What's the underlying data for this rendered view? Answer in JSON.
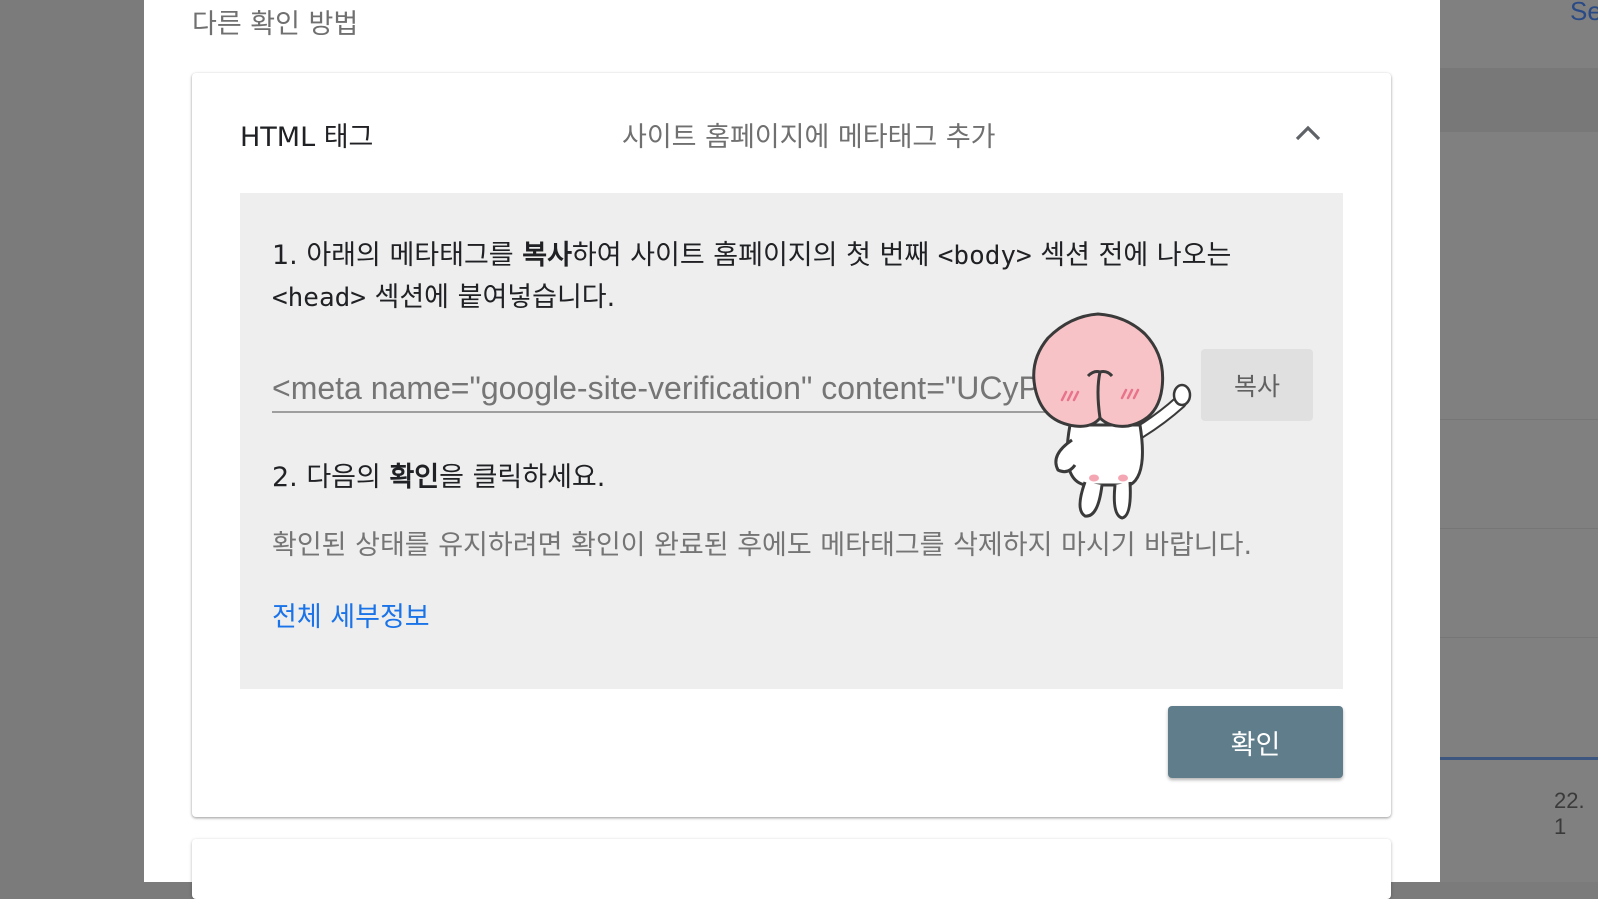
{
  "background": {
    "link_partial": "Se",
    "date_left_partial": ".",
    "date_right_partial": "22. 1"
  },
  "dialog": {
    "section_title": "다른 확인 방법",
    "method": {
      "name": "HTML 태그",
      "description": "사이트 홈페이지에 메타태그 추가",
      "expanded": true
    },
    "step1": {
      "prefix": "1. 아래의 메타태그를 ",
      "bold": "복사",
      "middle": "하여 사이트 홈페이지의 첫 번째 ",
      "body_tag": "<body>",
      "after_body": " 섹션 전에 나오는 ",
      "head_tag": "<head>",
      "suffix": " 섹션에 붙여넣습니다."
    },
    "meta_field_value": "<meta name=\"google-site-verification\" content=\"UCyP6l",
    "copy_label": "복사",
    "step2": {
      "prefix": "2. 다음의 ",
      "bold": "확인",
      "suffix": "을 클릭하세요."
    },
    "note": "확인된 상태를 유지하려면 확인이 완료된 후에도 메타태그를 삭제하지 마시기 바랍니다.",
    "details_link": "전체 세부정보",
    "verify_label": "확인"
  },
  "icons": {
    "collapse": "chevron-up-icon",
    "sticker": "peach-character-sticker"
  },
  "colors": {
    "verify_button": "#607d8b",
    "link": "#1a73e8",
    "panel_bg": "#eeeeee",
    "overlay": "#7b7b7b"
  }
}
